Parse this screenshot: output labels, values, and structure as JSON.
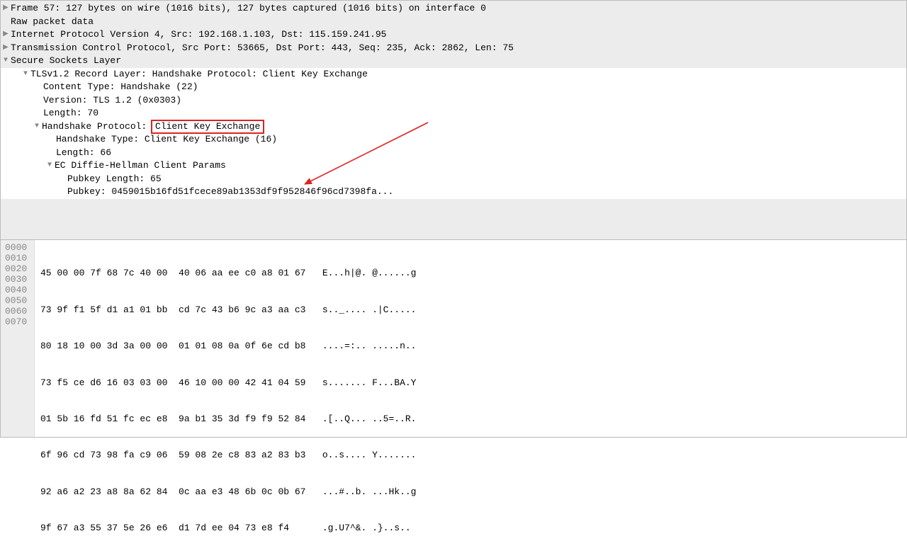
{
  "tree": {
    "frame": "Frame 57: 127 bytes on wire (1016 bits), 127 bytes captured (1016 bits) on interface 0",
    "raw": "Raw packet data",
    "ip": "Internet Protocol Version 4, Src: 192.168.1.103, Dst: 115.159.241.95",
    "tcp": "Transmission Control Protocol, Src Port: 53665, Dst Port: 443, Seq: 235, Ack: 2862, Len: 75",
    "ssl": "Secure Sockets Layer",
    "record": "TLSv1.2 Record Layer: Handshake Protocol: Client Key Exchange",
    "content_type": "Content Type: Handshake (22)",
    "version": "Version: TLS 1.2 (0x0303)",
    "length70": "Length: 70",
    "handshake_prefix": "Handshake Protocol: ",
    "handshake_boxed": "Client Key Exchange",
    "handshake_type": "Handshake Type: Client Key Exchange (16)",
    "length66": "Length: 66",
    "ecdh": "EC Diffie-Hellman Client Params",
    "pubkey_len": "Pubkey Length: 65",
    "pubkey": "Pubkey: 0459015b16fd51fcece89ab1353df9f952846f96cd7398fa..."
  },
  "hex": {
    "offsets": [
      "0000",
      "0010",
      "0020",
      "0030",
      "0040",
      "0050",
      "0060",
      "0070"
    ],
    "lines": [
      "45 00 00 7f 68 7c 40 00  40 06 aa ee c0 a8 01 67   E...h|@. @......g",
      "73 9f f1 5f d1 a1 01 bb  cd 7c 43 b6 9c a3 aa c3   s.._.... .|C.....",
      "80 18 10 00 3d 3a 00 00  01 01 08 0a 0f 6e cd b8   ....=:.. .....n..",
      "73 f5 ce d6 16 03 03 00  46 10 00 00 42 41 04 59   s....... F...BA.Y",
      "01 5b 16 fd 51 fc ec e8  9a b1 35 3d f9 f9 52 84   .[..Q... ..5=..R.",
      "6f 96 cd 73 98 fa c9 06  59 08 2e c8 83 a2 83 b3   o..s.... Y.......",
      "92 a6 a2 23 a8 8a 62 84  0c aa e3 48 6b 0c 0b 67   ...#..b. ...Hk..g",
      "9f 67 a3 55 37 5e 26 e6  d1 7d ee 04 73 e8 f4      .g.U7^&. .}..s.."
    ]
  }
}
